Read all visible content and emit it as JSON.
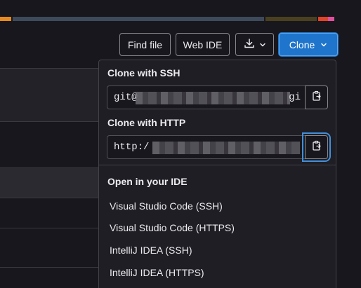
{
  "colors": {
    "page_bg": "#18171d",
    "dropdown_bg": "#1f1e24",
    "primary_button": "#1f75cb",
    "focus_ring": "#428fdc",
    "lang_segments": [
      "#e68a20",
      "#3d4a5c",
      "#4a4020",
      "#e24329",
      "#e24f9c"
    ]
  },
  "toolbar": {
    "find_file_label": "Find file",
    "web_ide_label": "Web IDE",
    "download_icon": "download-icon",
    "clone_label": "Clone"
  },
  "clone_dropdown": {
    "ssh_title": "Clone with SSH",
    "ssh_url_start": "git@",
    "ssh_url_end": "gi",
    "http_title": "Clone with HTTP",
    "http_url_start": "http:/",
    "ide_title": "Open in your IDE",
    "ide_options": [
      "Visual Studio Code (SSH)",
      "Visual Studio Code (HTTPS)",
      "IntelliJ IDEA (SSH)",
      "IntelliJ IDEA (HTTPS)"
    ],
    "copy_icon": "clipboard-icon"
  }
}
